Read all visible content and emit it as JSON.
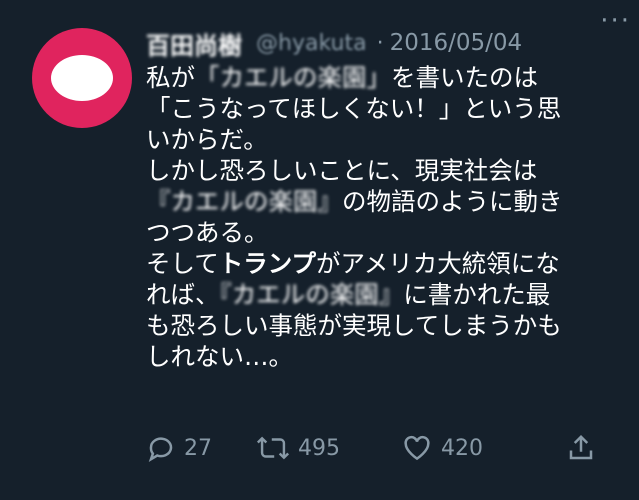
{
  "author": {
    "name": "百田尚樹",
    "handle": "@hyakuta",
    "separator": "·",
    "date": "2016/05/04",
    "more_label": "···"
  },
  "body": {
    "lines": [
      [
        "私が",
        "「カエルの楽園」",
        "を書いたのは"
      ],
      [
        "「こうなってほしくない！」という思"
      ],
      [
        "いからだ。"
      ],
      [
        "しかし恐ろしいことに、現実社会は"
      ],
      [
        "『カエルの楽園』",
        "の物語のように動き"
      ],
      [
        "つつある。"
      ],
      [
        "そして",
        "トランプ",
        "がアメリカ大統領にな"
      ],
      [
        "れば、",
        "『カエルの楽園』",
        "に書かれた最"
      ],
      [
        "も恐ろしい事態が実現してしまうかも"
      ],
      [
        "しれない…。"
      ]
    ]
  },
  "actions": {
    "reply_count": "27",
    "retweet_count": "495",
    "like_count": "420"
  },
  "icons": {
    "reply": "reply-icon",
    "retweet": "retweet-icon",
    "like": "heart-icon",
    "share": "share-icon"
  },
  "colors": {
    "background": "#15202b",
    "text": "#ffffff",
    "muted": "#8899a6",
    "avatar": "#e0245e"
  }
}
